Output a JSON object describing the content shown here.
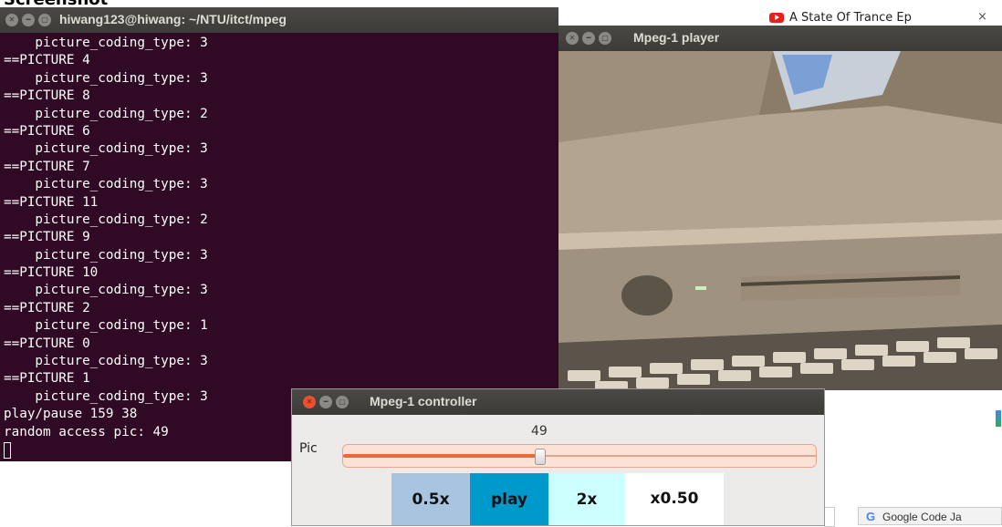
{
  "terminal": {
    "title": "hiwang123@hiwang: ~/NTU/itct/mpeg",
    "lines": [
      "    picture_coding_type: 3",
      "==PICTURE 4",
      "    picture_coding_type: 3",
      "==PICTURE 8",
      "    picture_coding_type: 2",
      "==PICTURE 6",
      "    picture_coding_type: 3",
      "==PICTURE 7",
      "    picture_coding_type: 3",
      "==PICTURE 11",
      "    picture_coding_type: 2",
      "==PICTURE 9",
      "    picture_coding_type: 3",
      "==PICTURE 10",
      "    picture_coding_type: 3",
      "==PICTURE 2",
      "    picture_coding_type: 1",
      "==PICTURE 0",
      "    picture_coding_type: 3",
      "==PICTURE 1",
      "    picture_coding_type: 3",
      "play/pause 159 38",
      "random access pic: 49"
    ],
    "bg_color": "#300a24"
  },
  "player": {
    "title": "Mpeg-1 player"
  },
  "controller": {
    "title": "Mpeg-1 controller",
    "pic_label": "Pic",
    "pic_value": "49",
    "slider_fraction": 0.415,
    "buttons": {
      "half_speed": "0.5x",
      "play": "play",
      "double_speed": "2x",
      "rate_display": "x0.50"
    }
  },
  "browser": {
    "tab_title": "A State Of Trance Ep",
    "tab_close": "×",
    "second_tab_title": "Google Code Ja"
  },
  "colors": {
    "ubuntu_orange": "#f0673a",
    "button_blue_light": "#a8c4e0",
    "button_blue_dark": "#0099cc",
    "button_cyan": "#ccffff",
    "youtube_red": "#e62117"
  }
}
